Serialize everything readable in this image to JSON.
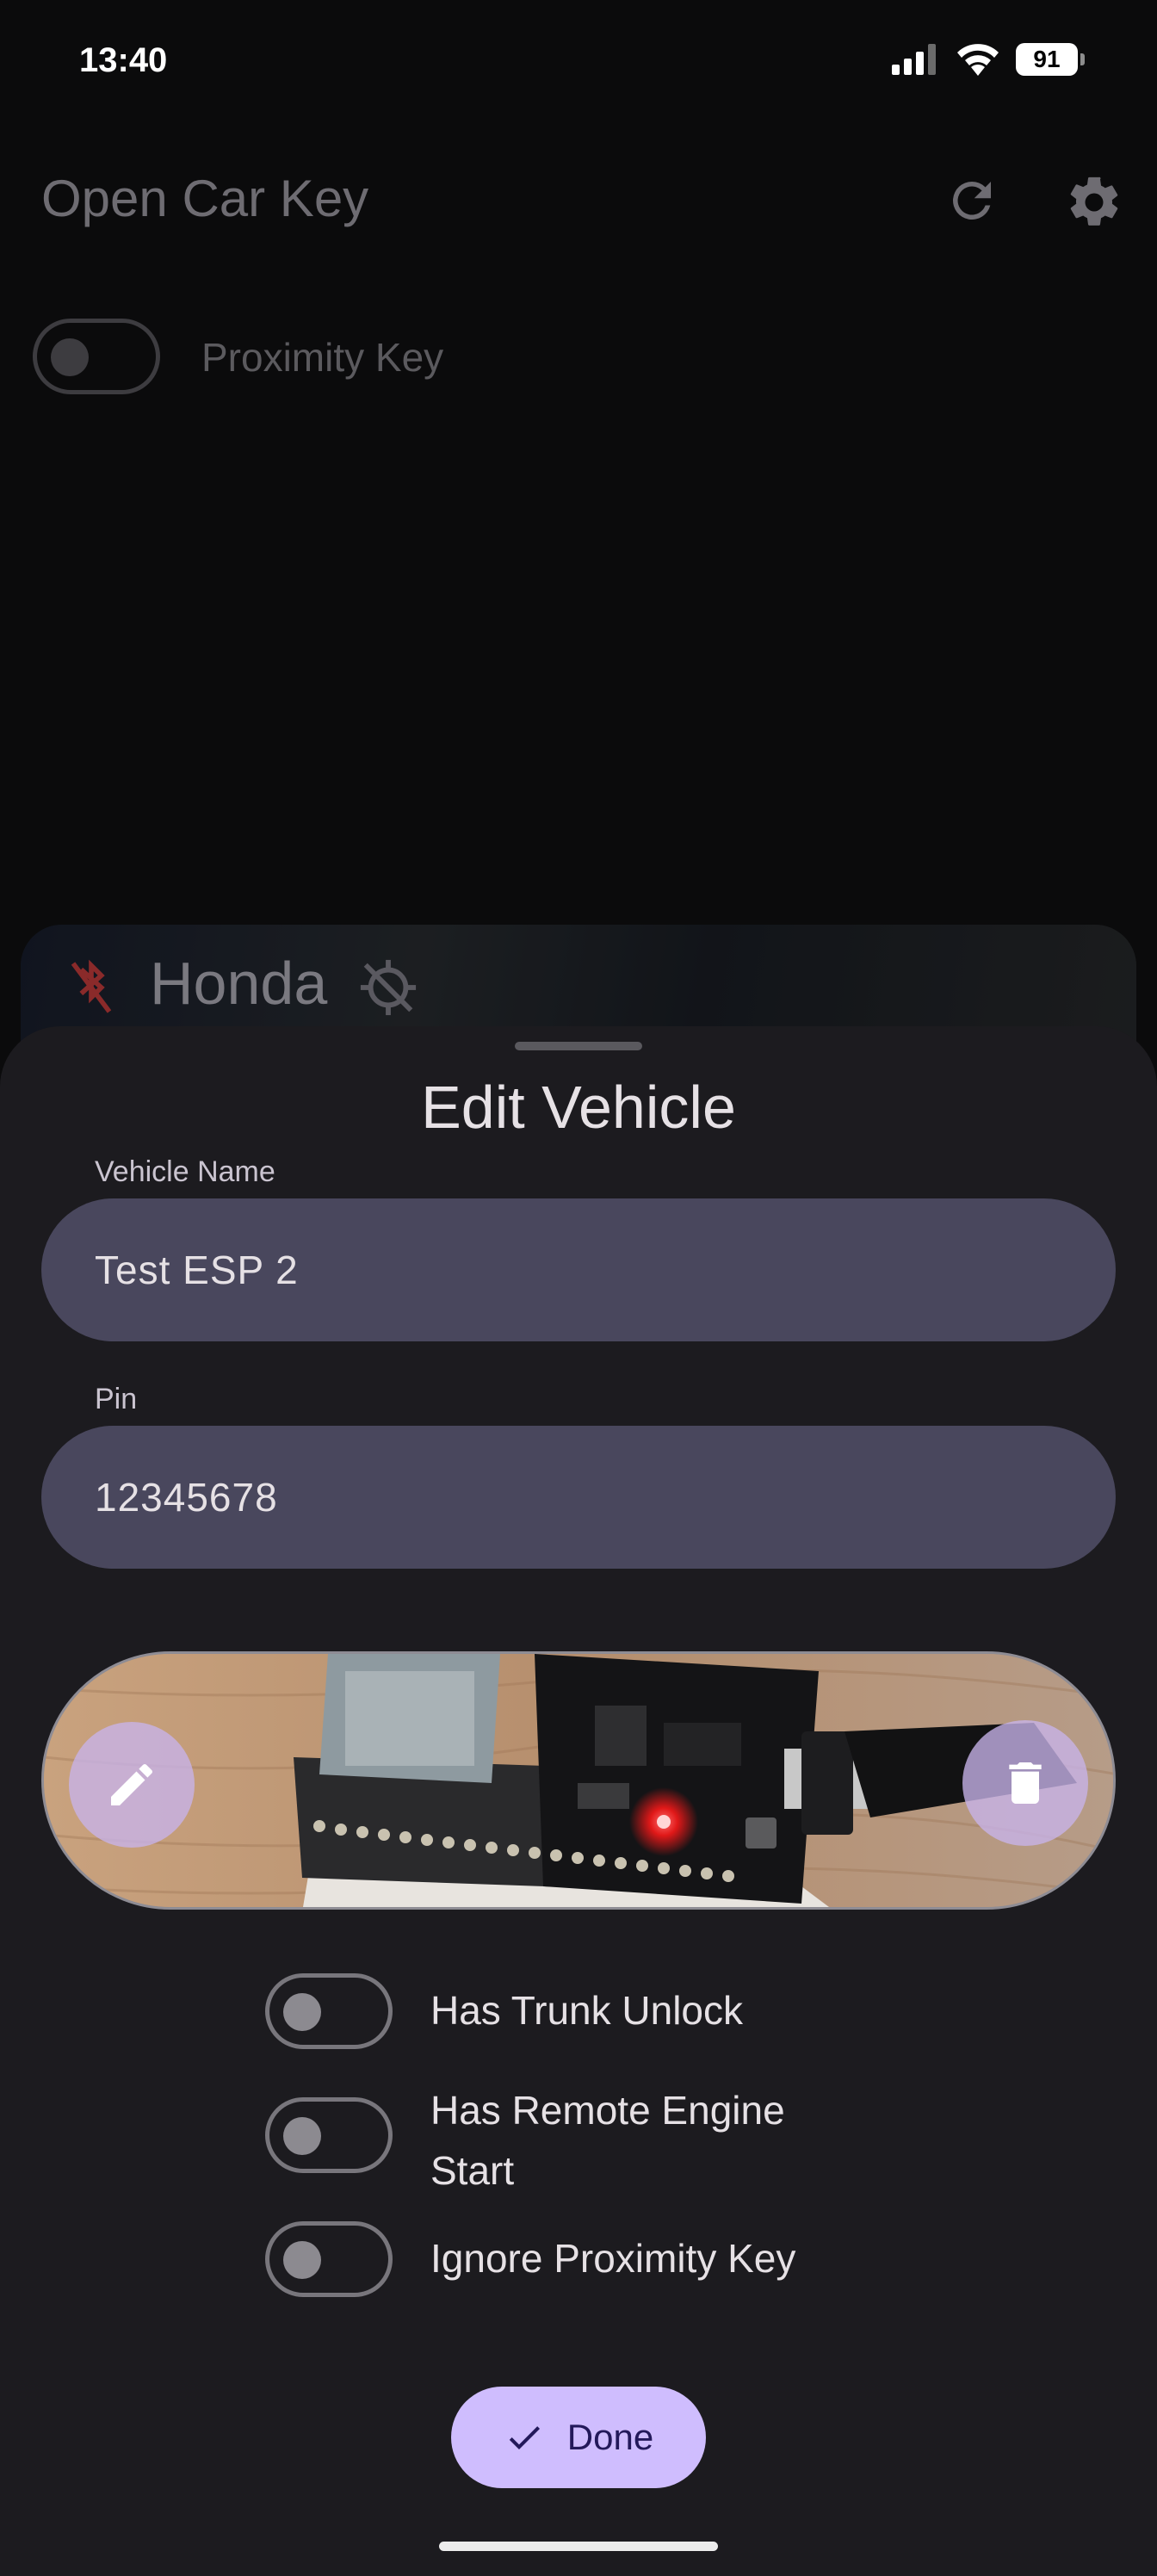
{
  "status_bar": {
    "time": "13:40",
    "battery": "91"
  },
  "app_bar": {
    "title": "Open Car Key"
  },
  "proximity": {
    "label": "Proximity Key",
    "enabled": false
  },
  "vehicle_card": {
    "name": "Honda"
  },
  "sheet": {
    "title": "Edit Vehicle",
    "vehicle_name": {
      "label": "Vehicle Name",
      "value": "Test ESP 2"
    },
    "pin": {
      "label": "Pin",
      "value": "12345678"
    },
    "toggles": [
      {
        "label": "Has Trunk Unlock",
        "enabled": false
      },
      {
        "label": "Has Remote Engine Start",
        "enabled": false
      },
      {
        "label": "Ignore Proximity Key",
        "enabled": false
      }
    ],
    "done_label": "Done"
  },
  "colors": {
    "accent": "#cfbdfe",
    "field_bg": "#49475d",
    "sheet_bg": "#1c1b1f"
  }
}
